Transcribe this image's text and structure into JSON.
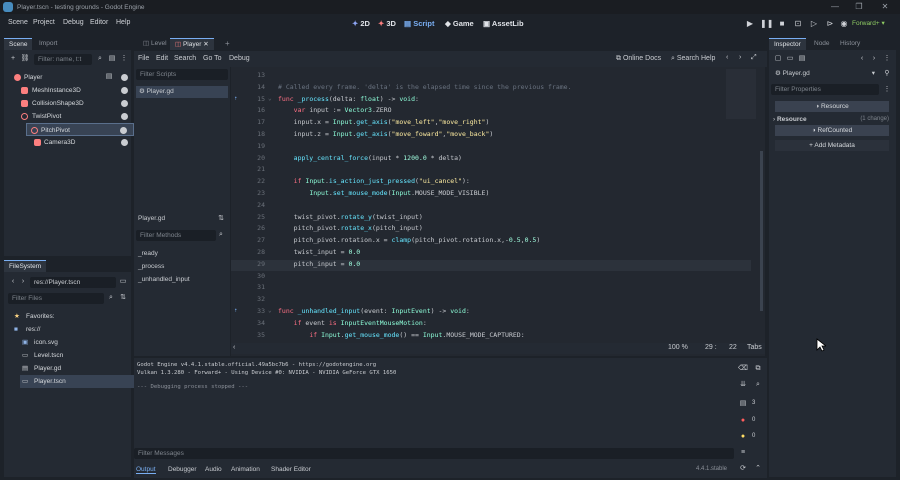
{
  "titlebar": {
    "title": "Player.tscn - testing grounds - Godot Engine",
    "min": "—",
    "max": "❐",
    "close": "✕"
  },
  "menus": [
    "Scene",
    "Project",
    "Debug",
    "Editor",
    "Help"
  ],
  "workspaces": [
    {
      "label": "2D",
      "icon": "2d-icon"
    },
    {
      "label": "3D",
      "icon": "3d-icon"
    },
    {
      "label": "Script",
      "icon": "script-icon"
    },
    {
      "label": "Game",
      "icon": "game-icon"
    },
    {
      "label": "AssetLib",
      "icon": "assetlib-icon"
    }
  ],
  "renderer": "Forward+",
  "scene_dock": {
    "tabs": [
      "Scene",
      "Import"
    ],
    "filter_placeholder": "Filter: name, t:t",
    "nodes": [
      {
        "name": "Player",
        "color": "#fc7f7f",
        "depth": 0
      },
      {
        "name": "MeshInstance3D",
        "color": "#fc7f7f",
        "depth": 1
      },
      {
        "name": "CollisionShape3D",
        "color": "#fc7f7f",
        "depth": 1
      },
      {
        "name": "TwistPivot",
        "color": "#fc7f7f",
        "depth": 1
      },
      {
        "name": "PitchPivot",
        "color": "#fc7f7f",
        "depth": 2
      },
      {
        "name": "Camera3D",
        "color": "#fc7f7f",
        "depth": 3
      }
    ]
  },
  "filesystem": {
    "tab": "FileSystem",
    "path": "res://Player.tscn",
    "filter_placeholder": "Filter Files",
    "items": [
      {
        "name": "Favorites:",
        "icon": "star-icon",
        "depth": 0
      },
      {
        "name": "res://",
        "icon": "folder-icon",
        "depth": 0
      },
      {
        "name": "icon.svg",
        "icon": "image-icon",
        "depth": 1
      },
      {
        "name": "Level.tscn",
        "icon": "scene-icon",
        "depth": 1
      },
      {
        "name": "Player.gd",
        "icon": "script-icon",
        "depth": 1
      },
      {
        "name": "Player.tscn",
        "icon": "scene-icon",
        "depth": 1
      }
    ]
  },
  "script_editor": {
    "tabs": [
      "Level",
      "Player"
    ],
    "menus": [
      "File",
      "Edit",
      "Search",
      "Go To",
      "Debug"
    ],
    "online_docs": "Online Docs",
    "search_help": "Search Help",
    "filter_scripts": "Filter Scripts",
    "scripts": [
      "Player.gd"
    ],
    "current_script": "Player.gd",
    "filter_methods": "Filter Methods",
    "methods": [
      "_ready",
      "_process",
      "_unhandled_input"
    ],
    "status": {
      "zoom": "100 %",
      "line": "29 :",
      "col": "22",
      "indent": "Tabs"
    }
  },
  "code_lines": [
    {
      "n": "13",
      "t": ""
    },
    {
      "n": "14",
      "t": "# Called every frame. 'delta' is the elapsed time since the previous frame.",
      "c": "cm"
    },
    {
      "n": "15",
      "t": "func _process(delta: float) -> void:",
      "c": "def"
    },
    {
      "n": "16",
      "t": "    var input := Vector3.ZERO",
      "c": "var"
    },
    {
      "n": "17",
      "t": "    input.x = Input.get_axis(\"move_left\",\"move_right\")",
      "c": "plain"
    },
    {
      "n": "18",
      "t": "    input.z = Input.get_axis(\"move_foward\",\"move_back\")",
      "c": "plain"
    },
    {
      "n": "19",
      "t": ""
    },
    {
      "n": "20",
      "t": "    apply_central_force(input * 1200.0 * delta)",
      "c": "plain"
    },
    {
      "n": "21",
      "t": ""
    },
    {
      "n": "22",
      "t": "    if Input.is_action_just_pressed(\"ui_cancel\"):",
      "c": "plain"
    },
    {
      "n": "23",
      "t": "        Input.set_mouse_mode(Input.MOUSE_MODE_VISIBLE)",
      "c": "plain"
    },
    {
      "n": "24",
      "t": ""
    },
    {
      "n": "25",
      "t": "    twist_pivot.rotate_y(twist_input)",
      "c": "plain"
    },
    {
      "n": "26",
      "t": "    pitch_pivot.rotate_x(pitch_input)",
      "c": "plain"
    },
    {
      "n": "27",
      "t": "    pitch_pivot.rotation.x = clamp(pitch_pivot.rotation.x,-0.5,0.5)",
      "c": "plain"
    },
    {
      "n": "28",
      "t": "    twist_input = 0.0",
      "c": "plain"
    },
    {
      "n": "29",
      "t": "    pitch_input = 0.0",
      "c": "plain"
    },
    {
      "n": "30",
      "t": ""
    },
    {
      "n": "31",
      "t": ""
    },
    {
      "n": "32",
      "t": ""
    },
    {
      "n": "33",
      "t": "func _unhandled_input(event: InputEvent) -> void:",
      "c": "def"
    },
    {
      "n": "34",
      "t": "    if event is InputEventMouseMotion:",
      "c": "plain"
    },
    {
      "n": "35",
      "t": "        if Input.get_mouse_mode() == Input.MOUSE_MODE_CAPTURED:",
      "c": "plain"
    }
  ],
  "output": {
    "lines": [
      "Godot Engine v4.4.1.stable.official.49a5bc7b6 - https://godotengine.org",
      "Vulkan 1.3.280 - Forward+ - Using Device #0: NVIDIA - NVIDIA GeForce GTX 1650",
      "",
      "--- Debugging process stopped ---"
    ],
    "filter": "Filter Messages",
    "tabs": [
      "Output",
      "Debugger",
      "Audio",
      "Animation",
      "Shader Editor"
    ],
    "version": "4.4.1.stable",
    "err_count": "0",
    "warn_count": "0",
    "count3": "3"
  },
  "inspector": {
    "tabs": [
      "Inspector",
      "Node",
      "History"
    ],
    "object": "Player.gd",
    "filter": "Filter Properties",
    "resource_btn": "Resource",
    "section": "Resource",
    "section_count": "(1 change)",
    "refcounted": "RefCounted",
    "add_metadata": "Add Metadata"
  }
}
